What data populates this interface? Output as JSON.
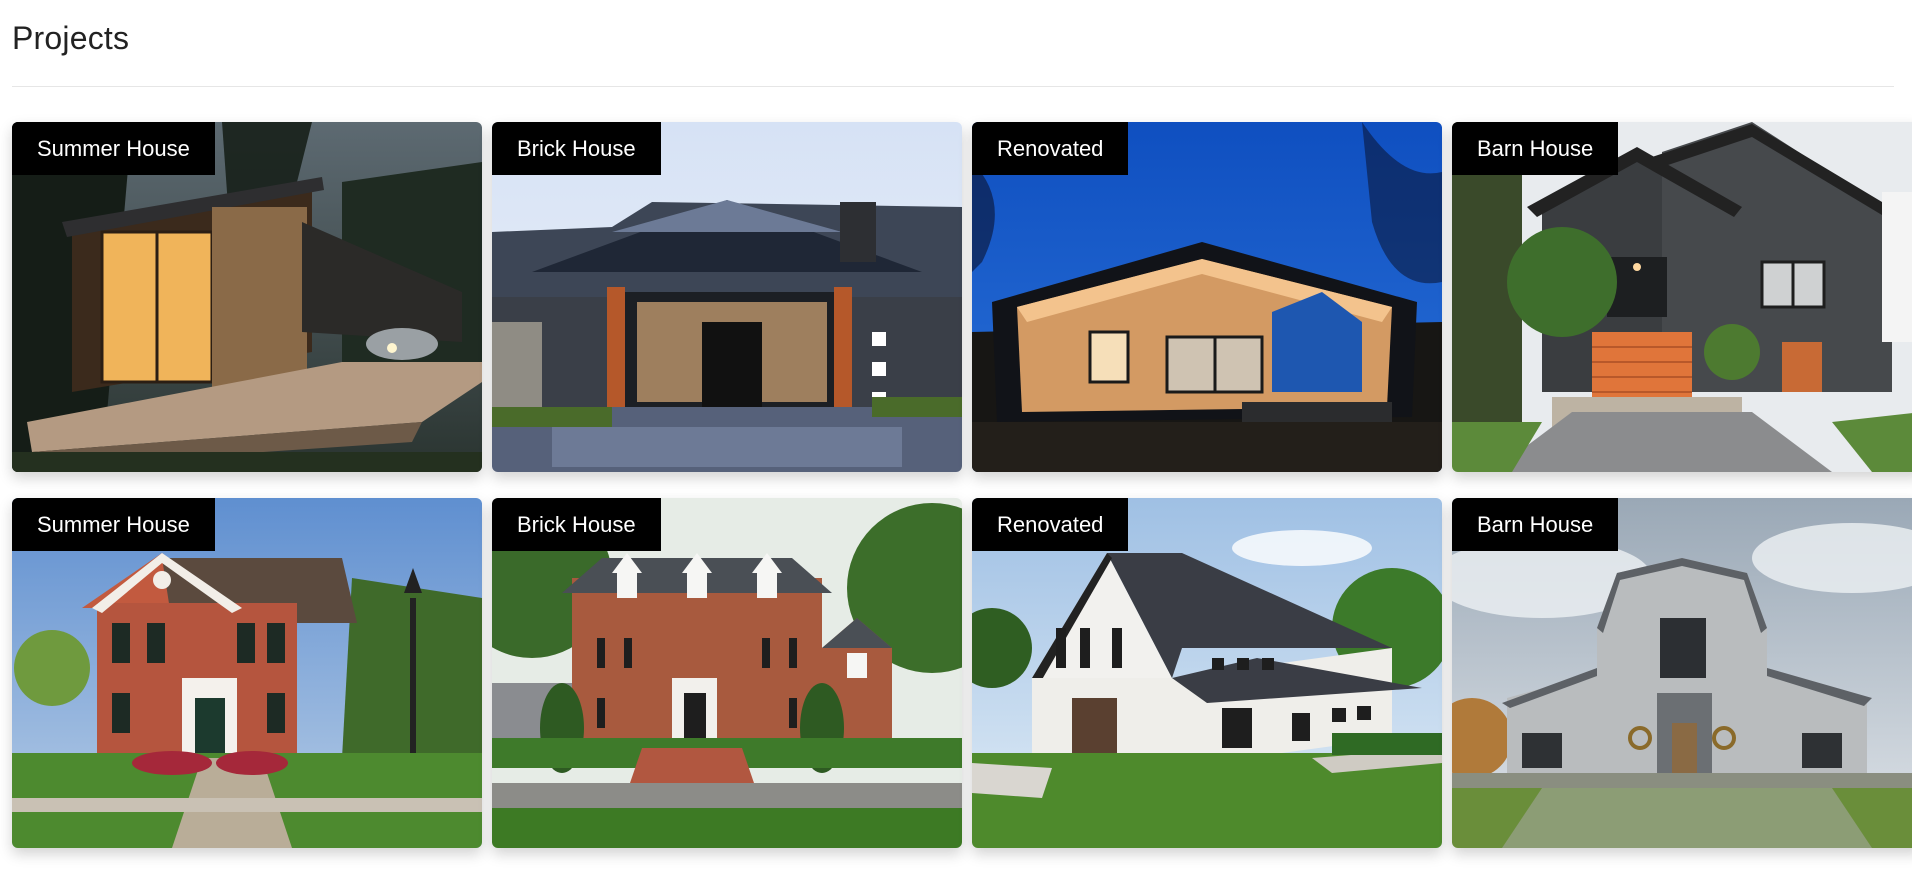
{
  "page": {
    "title": "Projects"
  },
  "projects": [
    {
      "tag": "Summer House",
      "image": "modern-wood-summer-house-dusk"
    },
    {
      "tag": "Brick House",
      "image": "modern-gabled-house-evening"
    },
    {
      "tag": "Renovated",
      "image": "wood-gable-house-night"
    },
    {
      "tag": "Barn House",
      "image": "dark-barn-house-orange-stairs"
    },
    {
      "tag": "Summer House",
      "image": "red-brick-colonial-with-lamp-post"
    },
    {
      "tag": "Brick House",
      "image": "brick-georgian-house-dormers"
    },
    {
      "tag": "Renovated",
      "image": "white-modern-farmhouse"
    },
    {
      "tag": "Barn House",
      "image": "gray-gambrel-barn-house"
    }
  ]
}
